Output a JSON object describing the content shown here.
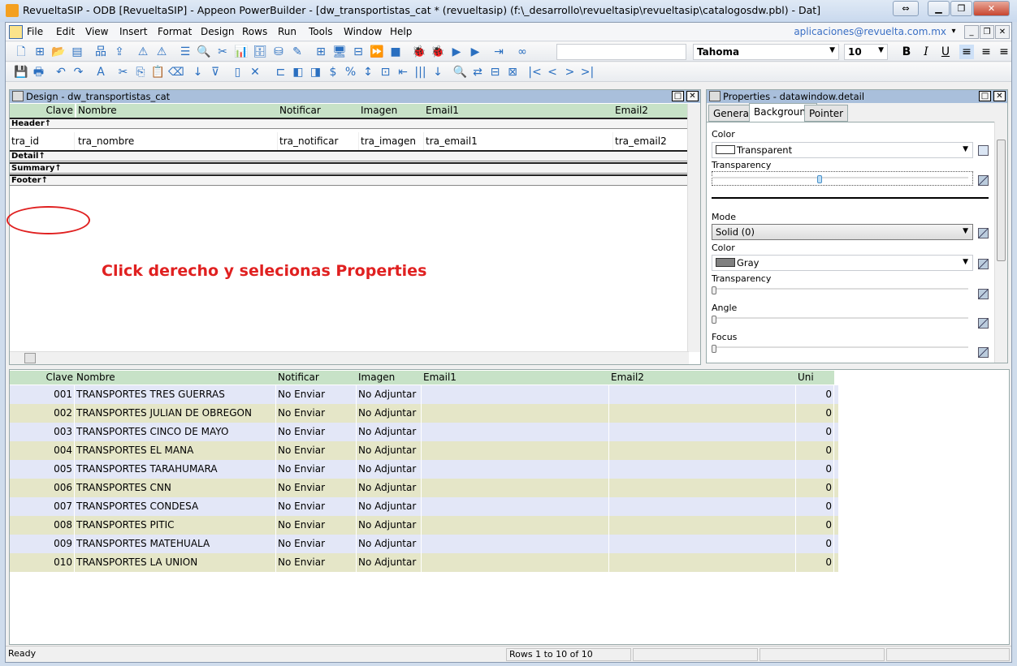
{
  "window": {
    "title": "RevueltaSIP - ODB [RevueltaSIP]  - Appeon PowerBuilder - [dw_transportistas_cat * (revueltasip) (f:\\_desarrollo\\revueltasip\\revueltasip\\catalogosdw.pbl) - Dat]",
    "buttons": [
      "⇔",
      "▁",
      "❐",
      "✕"
    ]
  },
  "menu": {
    "items": [
      "File",
      "Edit",
      "View",
      "Insert",
      "Format",
      "Design",
      "Rows",
      "Run",
      "Tools",
      "Window",
      "Help"
    ],
    "user": "aplicaciones@revuelta.com.mx",
    "mdi_buttons": [
      "▾",
      "_",
      "❐",
      "✕"
    ]
  },
  "toolbar1": {
    "icons": [
      [
        "new-icon",
        "🗋"
      ],
      [
        "inheritance-icon",
        "⊞"
      ],
      [
        "open-icon",
        "📂"
      ],
      [
        "library-icon",
        "▤"
      ],
      [
        "structure-icon",
        "品"
      ],
      [
        "deploy-icon",
        "⇪"
      ],
      [
        "check-in-icon",
        "⚠"
      ],
      [
        "check-out-icon",
        "⚠"
      ],
      [
        "list-icon",
        "☰"
      ],
      [
        "browse-icon",
        "🔍"
      ],
      [
        "cut-object-icon",
        "✂"
      ],
      [
        "chart-icon",
        "📊"
      ],
      [
        "database-icon",
        "🗄"
      ],
      [
        "db-profile-icon",
        "⛁"
      ],
      [
        "edit-icon",
        "✎"
      ],
      [
        "run-window-icon",
        "⊞"
      ],
      [
        "monitor-icon",
        "🖥"
      ],
      [
        "debug-window-icon",
        "⊟"
      ],
      [
        "next-icon",
        "⏩"
      ],
      [
        "stop-icon",
        "■"
      ],
      [
        "debug-icon",
        "🐞"
      ],
      [
        "debug-select-icon",
        "🐞"
      ],
      [
        "run-icon",
        "▶"
      ],
      [
        "select-run-icon",
        "▶"
      ],
      [
        "exit-icon",
        "⇥"
      ],
      [
        "appeon-icon",
        "∞"
      ]
    ],
    "font": "Tahoma",
    "font_size": "10",
    "format": [
      "B",
      "I",
      "U",
      "≡",
      "≡",
      "≡"
    ]
  },
  "toolbar2": {
    "icons": [
      [
        "save-icon",
        "💾"
      ],
      [
        "print-icon",
        "🖶"
      ],
      [
        "undo-icon",
        "↶"
      ],
      [
        "redo-icon",
        "↷"
      ],
      [
        "text-icon",
        "A"
      ],
      [
        "cut-icon",
        "✂"
      ],
      [
        "copy-icon",
        "⎘"
      ],
      [
        "paste-icon",
        "📋"
      ],
      [
        "clear-icon",
        "⌫"
      ],
      [
        "sort-icon",
        "↓"
      ],
      [
        "filter-icon",
        "⊽"
      ],
      [
        "import-icon",
        "▯"
      ],
      [
        "delete-icon",
        "✕"
      ],
      [
        "align-icon",
        "⊏"
      ],
      [
        "bring-front-icon",
        "◧"
      ],
      [
        "send-back-icon",
        "◨"
      ],
      [
        "currency-icon",
        "$"
      ],
      [
        "percent-icon",
        "%"
      ],
      [
        "space-icon",
        "↕"
      ],
      [
        "size-icon",
        "⊡"
      ],
      [
        "tab-order-icon",
        "⇤"
      ],
      [
        "columns-icon",
        "|||"
      ],
      [
        "sort-rows-icon",
        "↓"
      ],
      [
        "zoom-icon",
        "🔍"
      ],
      [
        "swap-icon",
        "⇄"
      ],
      [
        "group-icon",
        "⊟"
      ],
      [
        "ungroup-icon",
        "⊠"
      ],
      [
        "first-icon",
        "|<"
      ],
      [
        "prev-icon",
        "<"
      ],
      [
        "next-page-icon",
        ">"
      ],
      [
        "last-icon",
        ">|"
      ]
    ]
  },
  "design": {
    "title": "Design - dw_transportistas_cat",
    "headers": [
      "Clave",
      "Nombre",
      "Notificar",
      "Imagen",
      "Email1",
      "Email2"
    ],
    "columns": [
      "tra_id",
      "tra_nombre",
      "tra_notificar",
      "tra_imagen",
      "tra_email1",
      "tra_email2"
    ],
    "bands": [
      "Header↑",
      "Detail↑",
      "Summary↑",
      "Footer↑"
    ],
    "annotation": "Click derecho y selecionas Properties"
  },
  "properties": {
    "title": "Properties -  datawindow.detail",
    "tabs": [
      "General",
      "Background",
      "Pointer"
    ],
    "active_tab": "Background",
    "color_label": "Color",
    "color_value": "Transparent",
    "transparency_label": "Transparency",
    "transparency_value": 0.42,
    "mode_label": "Mode",
    "mode_value": "Solid (0)",
    "color2_label": "Color",
    "color2_value": "Gray",
    "color2_hex": "#808080",
    "transparency2_label": "Transparency",
    "angle_label": "Angle",
    "focus_label": "Focus"
  },
  "grid": {
    "headers": [
      "Clave",
      "Nombre",
      "Notificar",
      "Imagen",
      "Email1",
      "Email2",
      "Uni Neg"
    ],
    "rows": [
      [
        "001",
        "TRANSPORTES TRES GUERRAS",
        "No Enviar",
        "No Adjuntar",
        "",
        "",
        "0"
      ],
      [
        "002",
        "TRANSPORTES JULIAN DE OBREGON",
        "No Enviar",
        "No Adjuntar",
        "",
        "",
        "0"
      ],
      [
        "003",
        "TRANSPORTES CINCO DE MAYO",
        "No Enviar",
        "No Adjuntar",
        "",
        "",
        "0"
      ],
      [
        "004",
        "TRANSPORTES EL MANA",
        "No Enviar",
        "No Adjuntar",
        "",
        "",
        "0"
      ],
      [
        "005",
        "TRANSPORTES TARAHUMARA",
        "No Enviar",
        "No Adjuntar",
        "",
        "",
        "0"
      ],
      [
        "006",
        "TRANSPORTES CNN",
        "No Enviar",
        "No Adjuntar",
        "",
        "",
        "0"
      ],
      [
        "007",
        "TRANSPORTES CONDESA",
        "No Enviar",
        "No Adjuntar",
        "",
        "",
        "0"
      ],
      [
        "008",
        "TRANSPORTES PITIC",
        "No Enviar",
        "No Adjuntar",
        "",
        "",
        "0"
      ],
      [
        "009",
        "TRANSPORTES MATEHUALA",
        "No Enviar",
        "No Adjuntar",
        "",
        "",
        "0"
      ],
      [
        "010",
        "TRANSPORTES LA UNION",
        "No Enviar",
        "No Adjuntar",
        "",
        "",
        "0"
      ]
    ],
    "row_colors": [
      "#e3e7f7",
      "#e5e6c8"
    ],
    "header_color": "#c7e2c7"
  },
  "status": {
    "text": "Ready",
    "rows": "Rows 1 to 10 of 10"
  }
}
